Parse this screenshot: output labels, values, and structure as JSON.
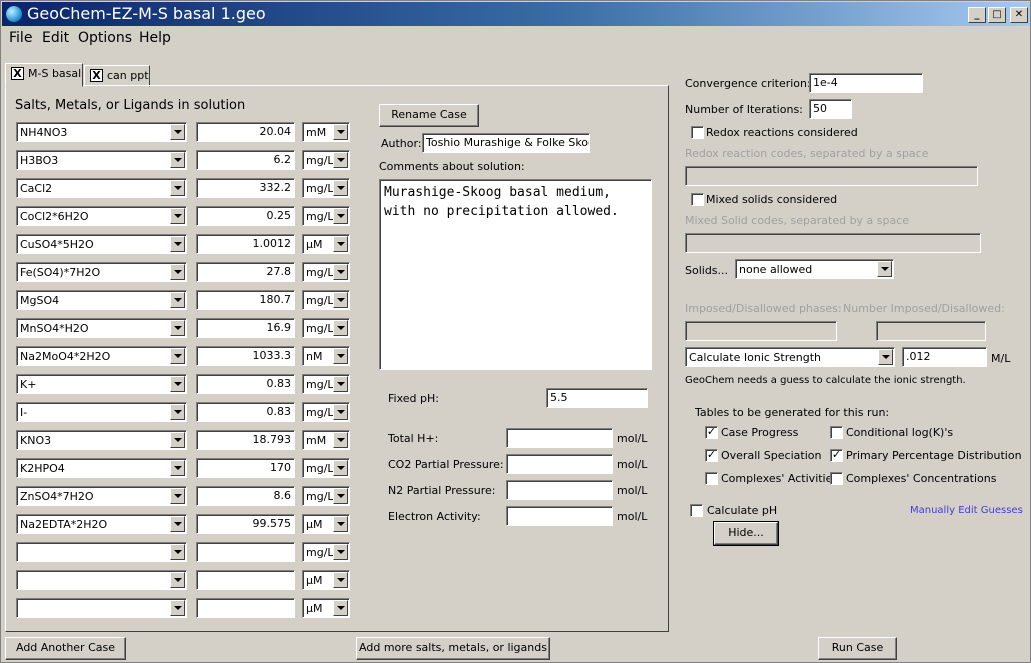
{
  "window": {
    "title": "GeoChem-EZ-M-S basal 1.geo",
    "minimize": "_",
    "maximize": "□",
    "close": "✕"
  },
  "menu": [
    "File",
    "Edit",
    "Options",
    "Help"
  ],
  "tabs": [
    {
      "label": "M-S basal",
      "close": "X"
    },
    {
      "label": "can ppt",
      "close": "X"
    }
  ],
  "left": {
    "heading": "Salts, Metals, or Ligands in solution",
    "rows": [
      {
        "name": "NH4NO3",
        "amount": "20.04",
        "unit": "mM"
      },
      {
        "name": "H3BO3",
        "amount": "6.2",
        "unit": "mg/L"
      },
      {
        "name": "CaCl2",
        "amount": "332.2",
        "unit": "mg/L"
      },
      {
        "name": "CoCl2*6H2O",
        "amount": "0.25",
        "unit": "mg/L"
      },
      {
        "name": "CuSO4*5H2O",
        "amount": "1.0012",
        "unit": "µM"
      },
      {
        "name": "Fe(SO4)*7H2O",
        "amount": "27.8",
        "unit": "mg/L"
      },
      {
        "name": "MgSO4",
        "amount": "180.7",
        "unit": "mg/L"
      },
      {
        "name": "MnSO4*H2O",
        "amount": "16.9",
        "unit": "mg/L"
      },
      {
        "name": "Na2MoO4*2H2O",
        "amount": "1033.3",
        "unit": "nM"
      },
      {
        "name": "K+",
        "amount": "0.83",
        "unit": "mg/L"
      },
      {
        "name": "I-",
        "amount": "0.83",
        "unit": "mg/L"
      },
      {
        "name": "KNO3",
        "amount": "18.793",
        "unit": "mM"
      },
      {
        "name": "K2HPO4",
        "amount": "170",
        "unit": "mg/L"
      },
      {
        "name": "ZnSO4*7H2O",
        "amount": "8.6",
        "unit": "mg/L"
      },
      {
        "name": "Na2EDTA*2H2O",
        "amount": "99.575",
        "unit": "µM"
      },
      {
        "name": "",
        "amount": "",
        "unit": "mg/L"
      },
      {
        "name": "",
        "amount": "",
        "unit": "µM"
      },
      {
        "name": "",
        "amount": "",
        "unit": "µM"
      }
    ]
  },
  "middle": {
    "rename_button": "Rename Case",
    "author_label": "Author:",
    "author_value": "Toshio Murashige &  Folke Skoog",
    "comments_label": "Comments about solution:",
    "comments_value": "Murashige-Skoog basal medium,\nwith no precipitation allowed.",
    "fixed_ph_label": "Fixed pH:",
    "fixed_ph_value": "5.5",
    "fields": [
      {
        "label": "Total H+:",
        "value": "",
        "unit": "mol/L"
      },
      {
        "label": "CO2 Partial Pressure:",
        "value": "",
        "unit": "mol/L"
      },
      {
        "label": "N2 Partial Pressure:",
        "value": "",
        "unit": "mol/L"
      },
      {
        "label": "Electron Activity:",
        "value": "",
        "unit": "mol/L"
      }
    ]
  },
  "right": {
    "convergence_label": "Convergence criterion:",
    "convergence_value": "1e-4",
    "iterations_label": "Number of Iterations:",
    "iterations_value": "50",
    "redox_label": "Redox reactions considered",
    "redox_codes_label": "Redox reaction codes, separated by a space",
    "mixed_label": "Mixed solids considered",
    "mixed_codes_label": "Mixed Solid codes, separated by a space",
    "solids_label": "Solids...",
    "solids_value": "none allowed",
    "imposed_label": "Imposed/Disallowed phases:",
    "number_imposed_label": "Number Imposed/Disallowed:",
    "ionic_select": "Calculate Ionic Strength",
    "ionic_value": ".012",
    "ionic_unit": "M/L",
    "ionic_hint": "GeoChem needs a guess to calculate the ionic strength.",
    "tables_label": "Tables to be generated for this run:",
    "tables": [
      {
        "label": "Case Progress",
        "checked": "✓"
      },
      {
        "label": "Conditional log(K)'s",
        "checked": ""
      },
      {
        "label": "Overall Speciation",
        "checked": "✓"
      },
      {
        "label": "Primary Percentage Distribution",
        "checked": "✓"
      },
      {
        "label": "Complexes' Activities",
        "checked": ""
      },
      {
        "label": "Complexes' Concentrations",
        "checked": ""
      }
    ],
    "calc_ph_label": "Calculate pH",
    "manual_link": "Manually Edit Guesses",
    "hide_button": "Hide..."
  },
  "bottom": {
    "add_case": "Add Another Case",
    "add_more": "Add more salts, metals, or ligands",
    "run": "Run Case"
  }
}
